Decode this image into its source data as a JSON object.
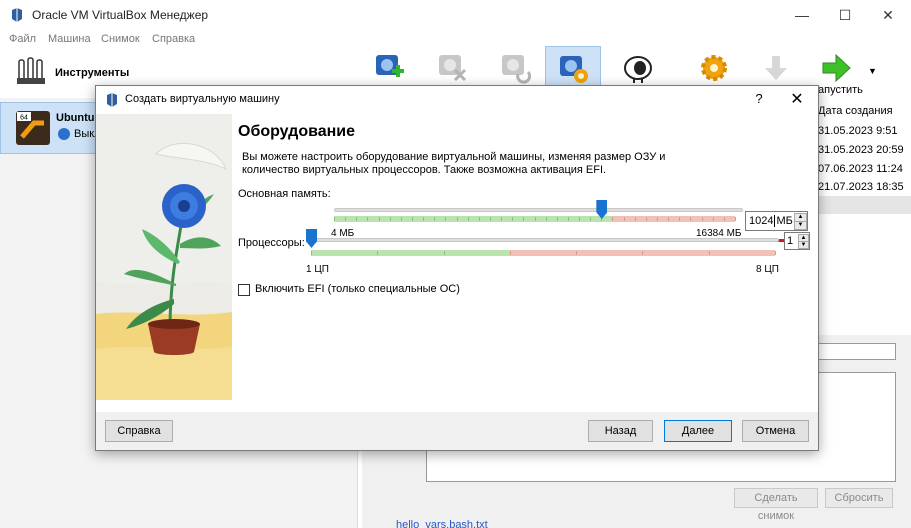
{
  "main": {
    "title": "Oracle VM VirtualBox Менеджер",
    "window_controls": [
      "—",
      "☐",
      "✕"
    ],
    "menu": [
      "Файл",
      "Машина",
      "Снимок",
      "Справка"
    ]
  },
  "tools": {
    "label": "Инструменты"
  },
  "vm": {
    "name": "Ubuntu",
    "status": "Выкл",
    "os_badge": "64"
  },
  "toolbar": {
    "start_label": "апустить",
    "dropdown": "▼"
  },
  "snapshots": {
    "header": "Дата создания",
    "dates": [
      "31.05.2023 9:51",
      "31.05.2023 20:59",
      "07.06.2023 11:24",
      "21.07.2023 18:35"
    ],
    "take_button": "Сделать снимок",
    "reset_button": "Сбросить",
    "file_link": "hello_vars.bash.txt"
  },
  "dialog": {
    "title": "Создать виртуальную машину",
    "help_glyph": "?",
    "close_glyph": "✕",
    "heading": "Оборудование",
    "description": "Вы можете настроить оборудование виртуальной машины, изменяя размер ОЗУ и количество виртуальных процессоров. Также возможна активация EFI.",
    "memory": {
      "label": "Основная память:",
      "value": "1024",
      "unit": "МБ",
      "min_label": "4 МБ",
      "max_label": "16384 МБ",
      "min": 4,
      "max": 16384,
      "current": 1024
    },
    "cpu": {
      "label": "Процессоры:",
      "value": "1",
      "min_label": "1 ЦП",
      "max_label": "8 ЦП",
      "min": 1,
      "max": 8,
      "current": 1
    },
    "efi": {
      "label": "Включить EFI (только специальные ОС)",
      "checked": false
    },
    "buttons": {
      "help": "Справка",
      "back": "Назад",
      "next": "Далее",
      "cancel": "Отмена"
    }
  },
  "colors": {
    "accent": "#1a73d1",
    "highlight_line": "#e0141e",
    "selection": "#cde2f7"
  }
}
